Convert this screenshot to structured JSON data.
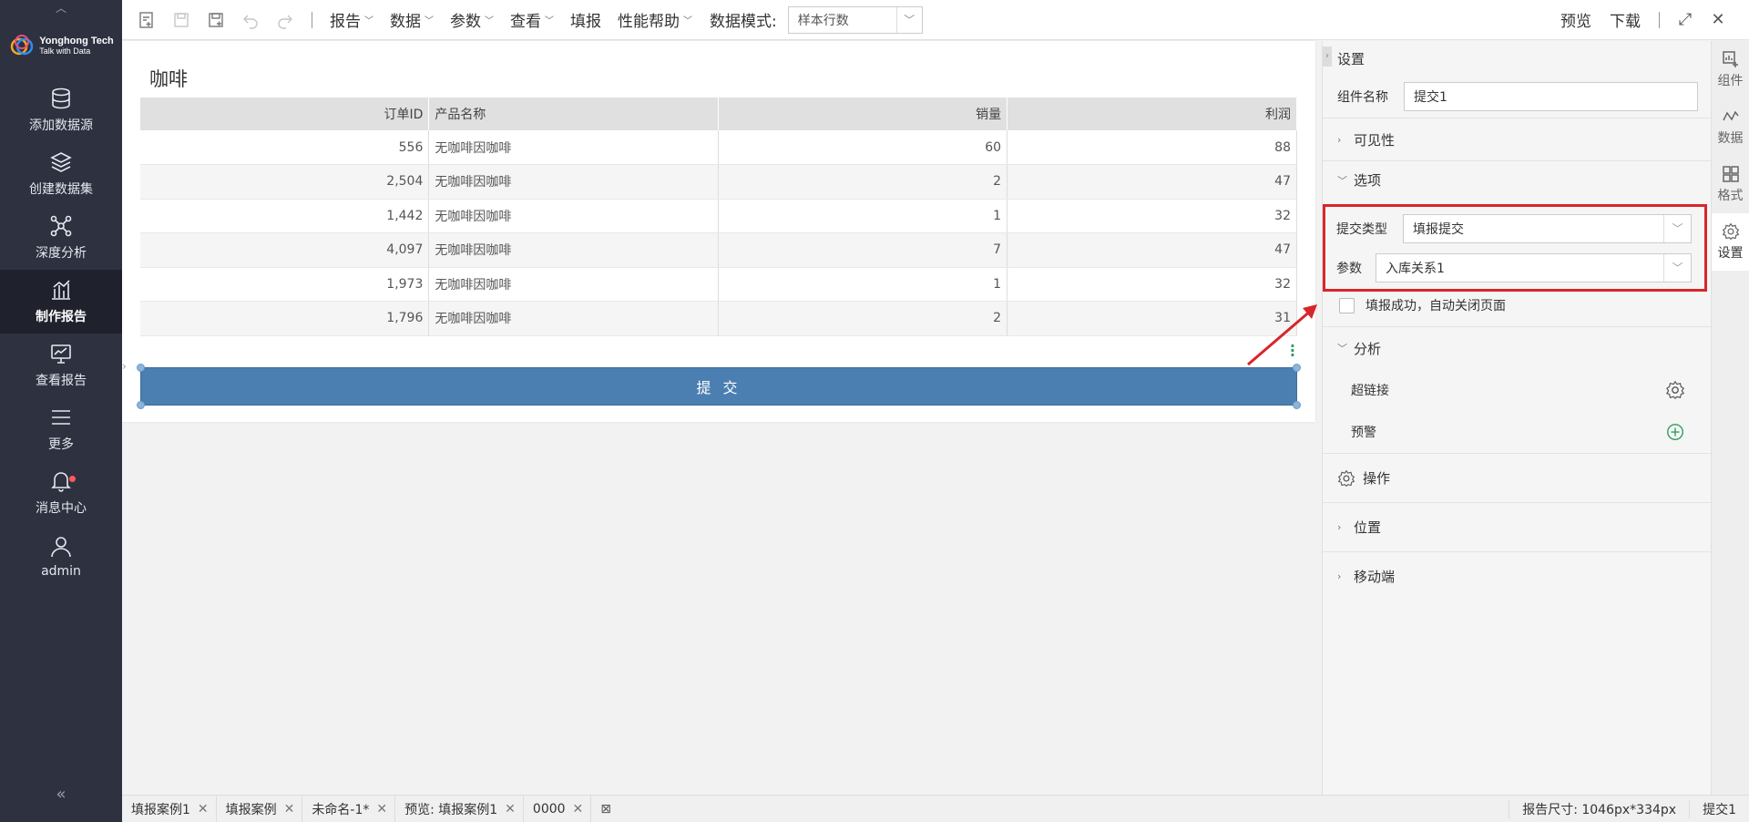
{
  "sidebar": {
    "logo": {
      "name": "Yonghong Tech",
      "tagline": "Talk with Data"
    },
    "items": [
      {
        "label": "添加数据源",
        "icon": "database-icon"
      },
      {
        "label": "创建数据集",
        "icon": "layers-icon"
      },
      {
        "label": "深度分析",
        "icon": "network-icon"
      },
      {
        "label": "制作报告",
        "icon": "bar-chart-icon",
        "active": true
      },
      {
        "label": "查看报告",
        "icon": "monitor-chart-icon"
      },
      {
        "label": "更多",
        "icon": "menu-icon"
      },
      {
        "label": "消息中心",
        "icon": "bell-icon",
        "badge": true
      },
      {
        "label": "admin",
        "icon": "user-icon"
      }
    ]
  },
  "toolbar": {
    "menus": [
      "报告",
      "数据",
      "参数",
      "查看"
    ],
    "fill_label": "填报",
    "perf_help": "性能帮助",
    "data_mode_label": "数据模式:",
    "data_mode_value": "样本行数",
    "preview": "预览",
    "download": "下载"
  },
  "report": {
    "title": "咖啡",
    "columns": [
      "订单ID",
      "产品名称",
      "销量",
      "利润"
    ],
    "rows": [
      [
        "556",
        "无咖啡因咖啡",
        "60",
        "88"
      ],
      [
        "2,504",
        "无咖啡因咖啡",
        "2",
        "47"
      ],
      [
        "1,442",
        "无咖啡因咖啡",
        "1",
        "32"
      ],
      [
        "4,097",
        "无咖啡因咖啡",
        "7",
        "47"
      ],
      [
        "1,973",
        "无咖啡因咖啡",
        "1",
        "32"
      ],
      [
        "1,796",
        "无咖啡因咖啡",
        "2",
        "31"
      ]
    ],
    "submit_label": "提 交"
  },
  "panel": {
    "title": "设置",
    "component_name_label": "组件名称",
    "component_name_value": "提交1",
    "visibility": "可见性",
    "options": "选项",
    "submit_type_label": "提交类型",
    "submit_type_value": "填报提交",
    "param_label": "参数",
    "param_value": "入库关系1",
    "auto_close_label": "填报成功，自动关闭页面",
    "analysis": "分析",
    "hyperlink": "超链接",
    "alert": "预警",
    "operation": "操作",
    "position": "位置",
    "mobile": "移动端"
  },
  "right_tabs": [
    {
      "label": "组件",
      "icon": "component-icon"
    },
    {
      "label": "数据",
      "icon": "data-line-icon"
    },
    {
      "label": "格式",
      "icon": "grid-icon"
    },
    {
      "label": "设置",
      "icon": "gear-icon",
      "active": true
    }
  ],
  "bottom_tabs": [
    "填报案例1",
    "填报案例",
    "未命名-1*",
    "预览: 填报案例1",
    "0000"
  ],
  "status": {
    "report_size": "报告尺寸: 1046px*334px",
    "selected": "提交1"
  },
  "colors": {
    "sidebar_bg": "#2e3140",
    "submit_button": "#4b7fb1",
    "highlight_border": "#d8262c"
  }
}
